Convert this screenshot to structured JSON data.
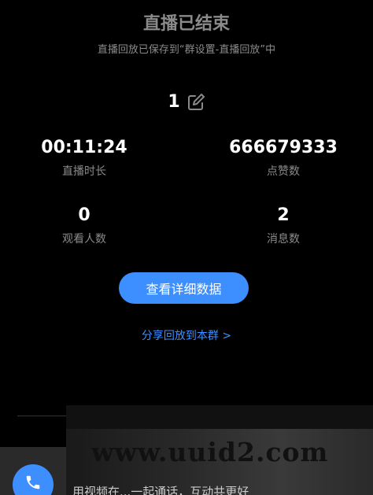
{
  "header": {
    "title": "直播已结束",
    "subtitle": "直播回放已保存到“群设置-直播回放”中"
  },
  "room": {
    "number": "1",
    "edit_icon": "edit-icon"
  },
  "stats": {
    "duration": {
      "value": "00:11:24",
      "label": "直播时长"
    },
    "likes": {
      "value": "666679333",
      "label": "点赞数"
    },
    "viewers": {
      "value": "0",
      "label": "观看人数"
    },
    "messages": {
      "value": "2",
      "label": "消息数"
    }
  },
  "actions": {
    "detail_button": "查看详细数据",
    "share_link": "分享回放到本群 >"
  },
  "watermark": "www.uuid2.com",
  "bottom": {
    "text": "用视频在...一起通话，互动共更好",
    "call_icon": "video-call-icon"
  },
  "colors": {
    "background": "#000000",
    "accent": "#3d8eff",
    "muted_text": "#8a8a8a",
    "text": "#ffffff"
  }
}
